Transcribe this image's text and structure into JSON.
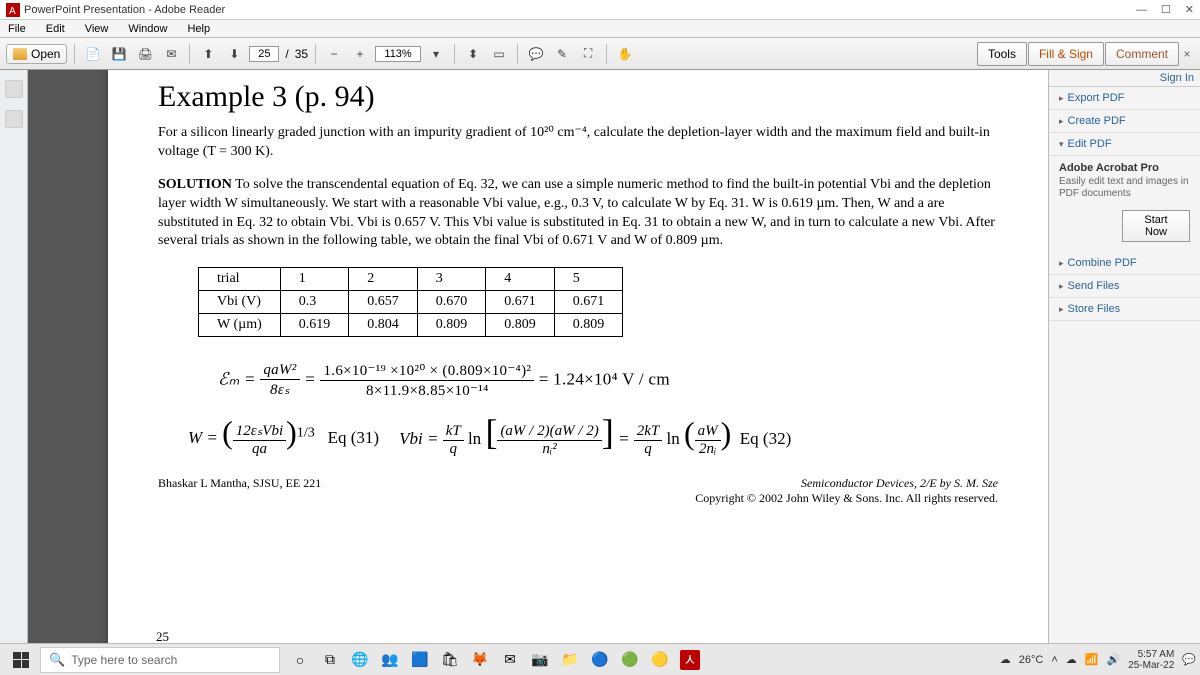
{
  "window": {
    "title": "PowerPoint Presentation - Adobe Reader"
  },
  "menu": [
    "File",
    "Edit",
    "View",
    "Window",
    "Help"
  ],
  "toolbar": {
    "open": "Open",
    "page_current": "25",
    "page_sep": "/",
    "page_total": "35",
    "zoom": "113%",
    "tools": "Tools",
    "fill_sign": "Fill & Sign",
    "comment": "Comment"
  },
  "rightpane": {
    "signin": "Sign In",
    "export": "Export PDF",
    "create": "Create PDF",
    "edit": "Edit PDF",
    "pro_title": "Adobe Acrobat Pro",
    "pro_desc": "Easily edit text and images in PDF documents",
    "start_now": "Start Now",
    "combine": "Combine PDF",
    "send": "Send Files",
    "store": "Store Files"
  },
  "doc": {
    "title": "Example 3 (p. 94)",
    "problem": "For a silicon linearly graded junction with an impurity gradient of 10²⁰ cm⁻⁴, calculate the depletion-layer width and the maximum field and built-in voltage (T = 300 K).",
    "solution_label": "SOLUTION",
    "solution_body": " To solve the transcendental equation of Eq. 32, we can use a simple numeric method to find the built-in potential Vbi and the depletion layer width W simultaneously. We start with a reasonable Vbi value, e.g., 0.3 V, to calculate W by Eq. 31. W is 0.619 µm. Then, W and a are substituted in Eq. 32 to obtain Vbi. Vbi is 0.657 V. This Vbi value is substituted in Eq. 31 to obtain a new W, and in turn to calculate a new Vbi. After several trials as shown in the following table, we obtain the final Vbi of 0.671 V and W of 0.809 µm.",
    "table": {
      "h": [
        "trial",
        "1",
        "2",
        "3",
        "4",
        "5"
      ],
      "r1": [
        "Vbi (V)",
        "0.3",
        "0.657",
        "0.670",
        "0.671",
        "0.671"
      ],
      "r2": [
        "W (µm)",
        "0.619",
        "0.804",
        "0.809",
        "0.809",
        "0.809"
      ]
    },
    "eq1_lhs": "ℰₘ =",
    "eq1_f1_num": "qaW²",
    "eq1_f1_den": "8εₛ",
    "eq1_eq": "=",
    "eq1_f2_num": "1.6×10⁻¹⁹ ×10²⁰ × (0.809×10⁻⁴)²",
    "eq1_f2_den": "8×11.9×8.85×10⁻¹⁴",
    "eq1_res": "= 1.24×10⁴ V / cm",
    "eq2_w": "W =",
    "eq2_w_num": "12εₛVbi",
    "eq2_w_den": "qa",
    "eq2_w_exp": "1/3",
    "eq2_w_lbl": "Eq (31)",
    "eq2_v": "Vbi =",
    "eq2_v_num1": "kT",
    "eq2_v_den1": "q",
    "eq2_ln": "ln",
    "eq2_v_num2": "(aW / 2)(aW / 2)",
    "eq2_v_den2": "nᵢ²",
    "eq2_mid": "=",
    "eq2_v_num3": "2kT",
    "eq2_v_den3": "q",
    "eq2_v_num4": "aW",
    "eq2_v_den4": "2nᵢ",
    "eq2_v_lbl": "Eq (32)",
    "foot_left": "Bhaskar L Mantha, SJSU, EE 221",
    "foot_r1": "Semiconductor Devices, 2/E by S. M. Sze",
    "foot_r2": "Copyright © 2002 John Wiley & Sons. Inc. All rights reserved.",
    "pagenum": "25"
  },
  "taskbar": {
    "search_placeholder": "Type here to search",
    "temp": "26°C",
    "time": "5:57 AM",
    "date": "25-Mar-22"
  }
}
